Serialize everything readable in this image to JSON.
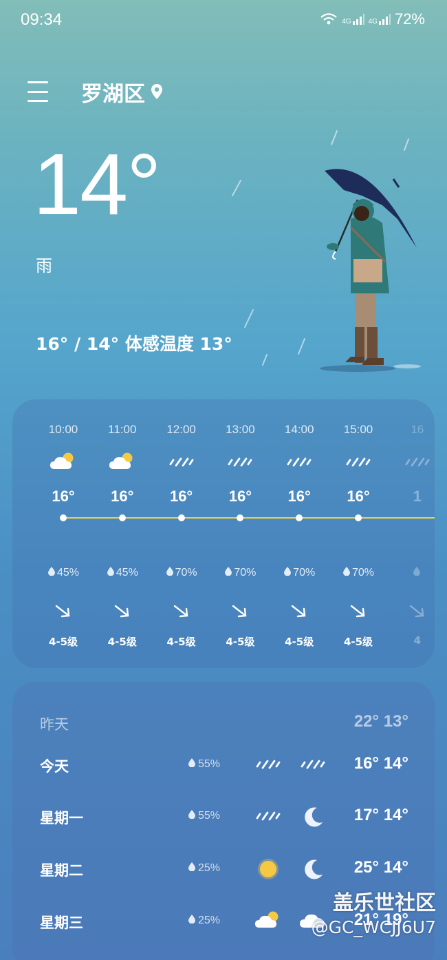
{
  "status": {
    "time": "09:34",
    "battery": "72%",
    "net1": "4G",
    "net2": "4G"
  },
  "header": {
    "city": "罗湖区"
  },
  "current": {
    "temp": "14°",
    "condition": "雨",
    "range": "16° / 14° 体感温度 13°"
  },
  "hourly": [
    {
      "time": "10:00",
      "icon": "partly-cloudy-icon",
      "temp": "16°",
      "pop": "45%",
      "wind": "4-5级"
    },
    {
      "time": "11:00",
      "icon": "partly-cloudy-icon",
      "temp": "16°",
      "pop": "45%",
      "wind": "4-5级"
    },
    {
      "time": "12:00",
      "icon": "rain-icon",
      "temp": "16°",
      "pop": "70%",
      "wind": "4-5级"
    },
    {
      "time": "13:00",
      "icon": "rain-icon",
      "temp": "16°",
      "pop": "70%",
      "wind": "4-5级"
    },
    {
      "time": "14:00",
      "icon": "rain-icon",
      "temp": "16°",
      "pop": "70%",
      "wind": "4-5级"
    },
    {
      "time": "15:00",
      "icon": "rain-icon",
      "temp": "16°",
      "pop": "70%",
      "wind": "4-5级"
    },
    {
      "time": "16",
      "icon": "rain-icon",
      "temp": "1",
      "pop": "",
      "wind": "4"
    }
  ],
  "daily": [
    {
      "day": "昨天",
      "pop": "",
      "icon_day": "",
      "icon_night": "",
      "temps": "22° 13°",
      "dim": true
    },
    {
      "day": "今天",
      "pop": "55%",
      "icon_day": "rain-icon",
      "icon_night": "rain-icon",
      "temps": "16° 14°",
      "dim": false
    },
    {
      "day": "星期一",
      "pop": "55%",
      "icon_day": "rain-icon",
      "icon_night": "moon-icon",
      "temps": "17° 14°",
      "dim": false
    },
    {
      "day": "星期二",
      "pop": "25%",
      "icon_day": "sun-icon",
      "icon_night": "moon-icon",
      "temps": "25° 14°",
      "dim": false
    },
    {
      "day": "星期三",
      "pop": "25%",
      "icon_day": "partly-cloudy-icon",
      "icon_night": "cloudy-icon",
      "temps": "21° 19°",
      "dim": false
    }
  ],
  "watermark": {
    "line1": "盖乐世社区",
    "line2": "@GC_WCJJ6U7"
  },
  "colors": {
    "temp_line": "#ecd24a",
    "sun": "#f6c945",
    "umbrella": "#1e2c5a",
    "coat": "#2f7a79"
  }
}
